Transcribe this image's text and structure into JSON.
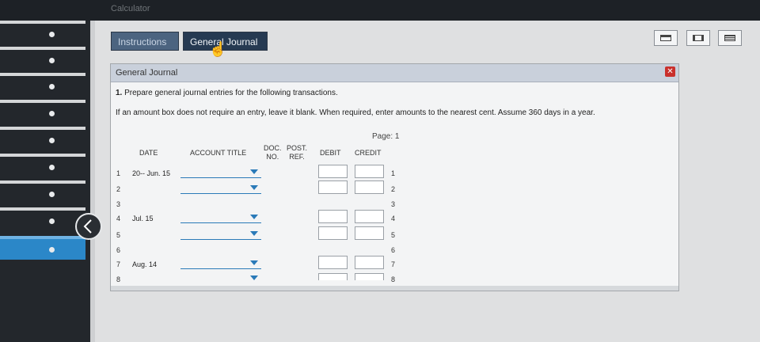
{
  "window": {
    "title": "Calculator"
  },
  "tabs": [
    {
      "label": "Instructions"
    },
    {
      "label": "General Journal"
    }
  ],
  "panel": {
    "title": "General Journal",
    "question_number": "1.",
    "question": "Prepare general journal entries for the following transactions.",
    "note": "If an amount box does not require an entry, leave it blank. When required, enter amounts to the nearest cent. Assume 360 days in a year.",
    "page_label": "Page: 1"
  },
  "columns": {
    "date": "DATE",
    "account": "ACCOUNT TITLE",
    "doc_line1": "DOC.",
    "doc_line2": "NO.",
    "post_line1": "POST.",
    "post_line2": "REF.",
    "debit": "DEBIT",
    "credit": "CREDIT"
  },
  "rows": [
    {
      "num": "1",
      "date": "20-- Jun. 15"
    },
    {
      "num": "2",
      "date": ""
    },
    {
      "num": "3",
      "date": ""
    },
    {
      "num": "4",
      "date": "Jul. 15"
    },
    {
      "num": "5",
      "date": ""
    },
    {
      "num": "6",
      "date": ""
    },
    {
      "num": "7",
      "date": "Aug. 14"
    },
    {
      "num": "8",
      "date": ""
    }
  ],
  "icons": [
    "back-arrow-icon",
    "close-icon",
    "view-compact-icon",
    "view-split-icon",
    "view-full-icon",
    "hand-cursor-icon"
  ]
}
